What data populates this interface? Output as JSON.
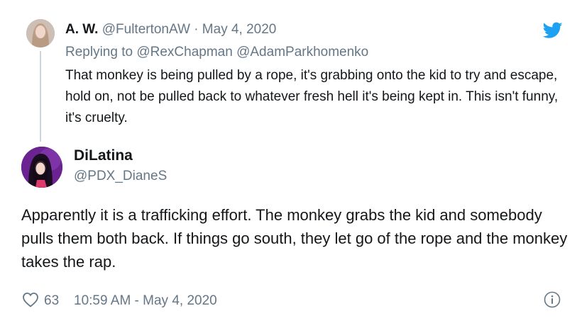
{
  "reply_tweet": {
    "name": "A. W.",
    "handle": "@FultertonAW",
    "separator": "·",
    "date": "May 4, 2020",
    "replying_prefix": "Replying to",
    "replying_to": [
      "@RexChapman",
      "@AdamParkhomenko"
    ],
    "text": "That monkey is being pulled by a rope, it's grabbing onto the kid to try and escape, hold on, not be pulled back to whatever fresh hell it's being kept in. This isn't funny, it's cruelty."
  },
  "main_tweet": {
    "name": "DiLatina",
    "handle": "@PDX_DianeS",
    "text": "Apparently it is a trafficking effort. The monkey grabs the kid and somebody pulls them both back. If things go south, they let go of the rope and the monkey takes the rap.",
    "like_count": "63",
    "timestamp": "10:59 AM - May 4, 2020"
  },
  "colors": {
    "twitter_blue": "#1da1f2",
    "secondary_text": "#657786",
    "primary_text": "#14171a",
    "thread_line": "#ccd6dd"
  },
  "icons": [
    "twitter-bird-icon",
    "heart-icon",
    "info-icon"
  ]
}
